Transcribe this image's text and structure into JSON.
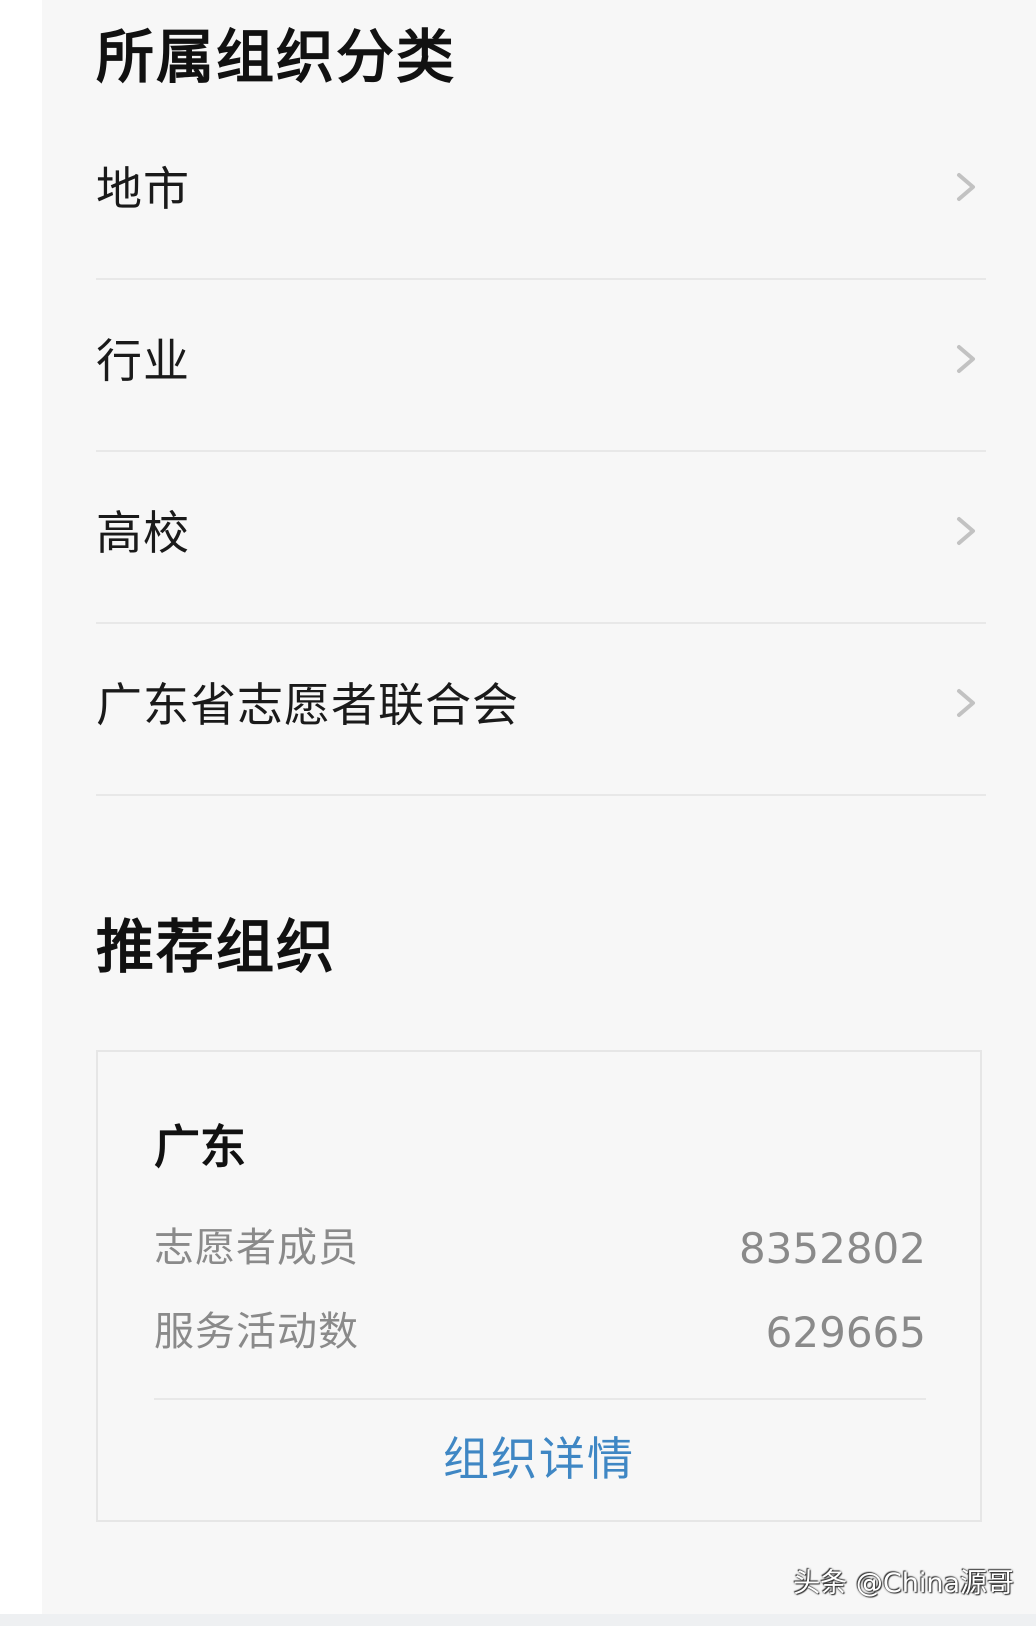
{
  "category_section": {
    "title": "所属组织分类",
    "items": [
      {
        "label": "地市",
        "icon": "chevron-right-icon"
      },
      {
        "label": "行业",
        "icon": "chevron-right-icon"
      },
      {
        "label": "高校",
        "icon": "chevron-right-icon"
      },
      {
        "label": "广东省志愿者联合会",
        "icon": "chevron-right-icon"
      }
    ]
  },
  "recommend_section": {
    "title": "推荐组织",
    "card": {
      "name": "广东",
      "stats": [
        {
          "label": "志愿者成员",
          "value": "8352802"
        },
        {
          "label": "服务活动数",
          "value": "629665"
        }
      ],
      "link_label": "组织详情",
      "link_color": "#3f87c4"
    }
  },
  "watermark": "头条 @China源哥"
}
